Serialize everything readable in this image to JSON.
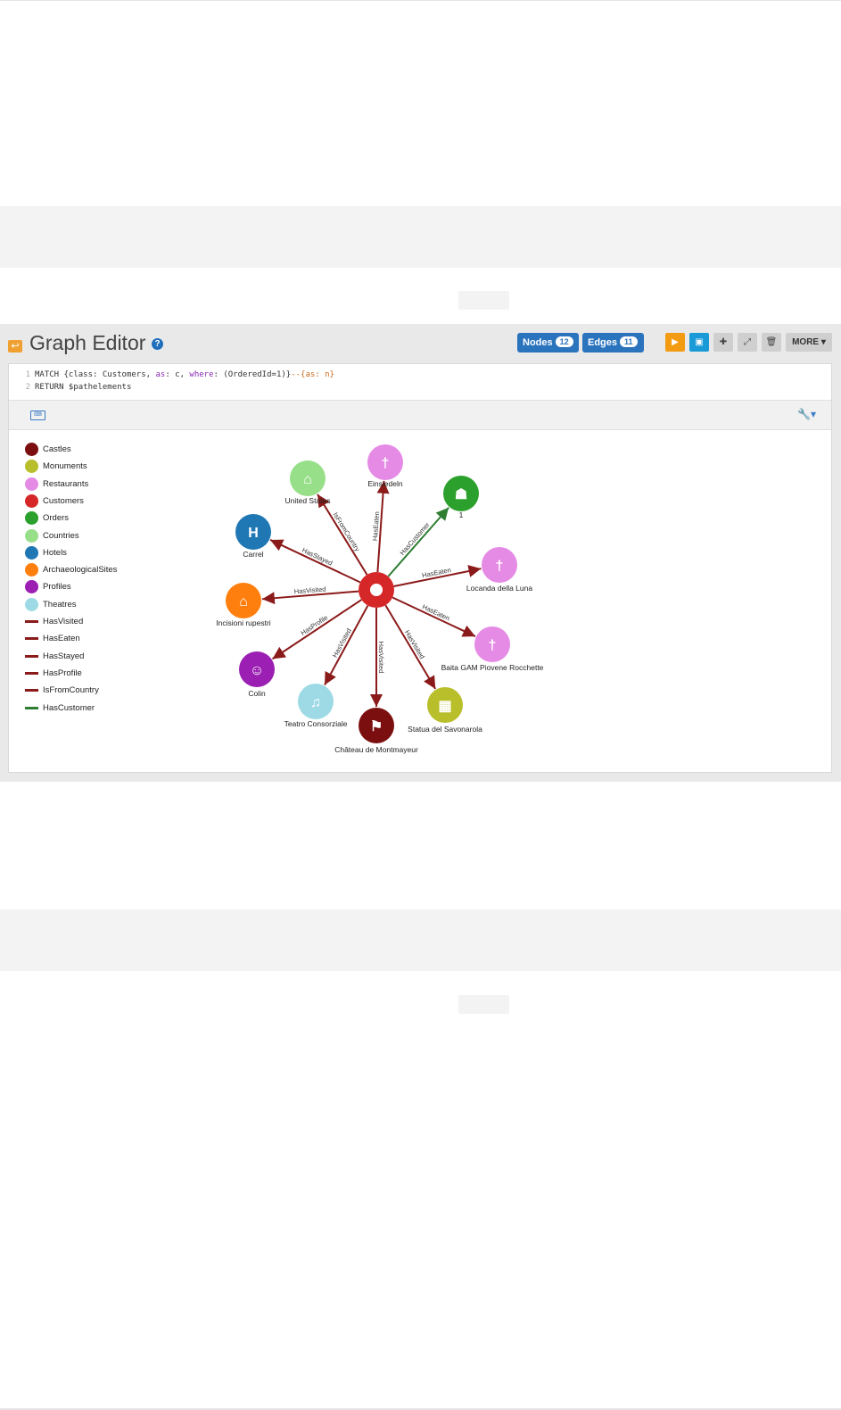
{
  "graph_editor": {
    "title": "Graph Editor",
    "help_icon": "?",
    "nodes_label": "Nodes",
    "nodes_count": "12",
    "edges_label": "Edges",
    "edges_count": "11",
    "more_label": "MORE",
    "tools": [
      "play-icon",
      "save-icon",
      "add-icon",
      "fullscreen-icon",
      "trash-icon"
    ]
  },
  "query": {
    "line1_num": "1",
    "line1_a": "MATCH {class: Customers, ",
    "line1_as": "as",
    "line1_b": ": c, ",
    "line1_where": "where",
    "line1_c": ": (OrderedId=1)}",
    "line1_d": "--{as: n}",
    "line2_num": "2",
    "line2": "RETURN $pathelements"
  },
  "legend": [
    {
      "label": "Castles",
      "kind": "node",
      "color": "#7b0f0f"
    },
    {
      "label": "Monuments",
      "kind": "node",
      "color": "#b9bf2a"
    },
    {
      "label": "Restaurants",
      "kind": "node",
      "color": "#e58be5"
    },
    {
      "label": "Customers",
      "kind": "node",
      "color": "#d62728"
    },
    {
      "label": "Orders",
      "kind": "node",
      "color": "#2ca02c"
    },
    {
      "label": "Countries",
      "kind": "node",
      "color": "#98df8a"
    },
    {
      "label": "Hotels",
      "kind": "node",
      "color": "#1f77b4"
    },
    {
      "label": "ArchaeologicalSites",
      "kind": "node",
      "color": "#ff7f0e"
    },
    {
      "label": "Profiles",
      "kind": "node",
      "color": "#9b1fb2"
    },
    {
      "label": "Theatres",
      "kind": "node",
      "color": "#9edae5"
    },
    {
      "label": "HasVisited",
      "kind": "edge",
      "color": "#8b1a1a"
    },
    {
      "label": "HasEaten",
      "kind": "edge",
      "color": "#8b1a1a"
    },
    {
      "label": "HasStayed",
      "kind": "edge",
      "color": "#8b1a1a"
    },
    {
      "label": "HasProfile",
      "kind": "edge",
      "color": "#8b1a1a"
    },
    {
      "label": "IsFromCountry",
      "kind": "edge",
      "color": "#8b1a1a"
    },
    {
      "label": "HasCustomer",
      "kind": "edge",
      "color": "#2e7d32"
    }
  ],
  "graph": {
    "center": {
      "label": "",
      "class": "Customers",
      "color": "#d62728"
    },
    "nodes": [
      {
        "label": "United States",
        "class": "Countries",
        "color": "#98df8a",
        "icon": "home-icon"
      },
      {
        "label": "Einsiedeln",
        "class": "Restaurants",
        "color": "#e58be5",
        "icon": "cutlery-icon"
      },
      {
        "label": "1",
        "class": "Orders",
        "color": "#2ca02c",
        "icon": "cart-icon"
      },
      {
        "label": "Locanda della Luna",
        "class": "Restaurants",
        "color": "#e58be5",
        "icon": "cutlery-icon"
      },
      {
        "label": "Baita GAM Piovene Rocchette",
        "class": "Restaurants",
        "color": "#e58be5",
        "icon": "cutlery-icon"
      },
      {
        "label": "Statua del Savonarola",
        "class": "Monuments",
        "color": "#b9bf2a",
        "icon": "building-icon"
      },
      {
        "label": "Château de Montmayeur",
        "class": "Castles",
        "color": "#7b0f0f",
        "icon": "bookmark-icon"
      },
      {
        "label": "Teatro Consorziale",
        "class": "Theatres",
        "color": "#9edae5",
        "icon": "music-icon"
      },
      {
        "label": "Colin",
        "class": "Profiles",
        "color": "#9b1fb2",
        "icon": "user-icon"
      },
      {
        "label": "Incisioni rupestri",
        "class": "ArchaeologicalSites",
        "color": "#ff7f0e",
        "icon": "bank-icon"
      },
      {
        "label": "Carrel",
        "class": "Hotels",
        "color": "#1f77b4",
        "icon": "hotel-icon"
      }
    ],
    "edges": [
      {
        "label": "IsFromCountry",
        "to": 0,
        "color": "#8b1a1a"
      },
      {
        "label": "HasEaten",
        "to": 1,
        "color": "#8b1a1a"
      },
      {
        "label": "HasCustomer",
        "to": 2,
        "color": "#2e7d32"
      },
      {
        "label": "HasEaten",
        "to": 3,
        "color": "#8b1a1a"
      },
      {
        "label": "HasEaten",
        "to": 4,
        "color": "#8b1a1a"
      },
      {
        "label": "HasVisited",
        "to": 5,
        "color": "#8b1a1a"
      },
      {
        "label": "HasVisited",
        "to": 6,
        "color": "#8b1a1a"
      },
      {
        "label": "HasVisited",
        "to": 7,
        "color": "#8b1a1a"
      },
      {
        "label": "HasProfile",
        "to": 8,
        "color": "#8b1a1a"
      },
      {
        "label": "HasVisited",
        "to": 9,
        "color": "#8b1a1a"
      },
      {
        "label": "HasStayed",
        "to": 10,
        "color": "#8b1a1a"
      }
    ]
  }
}
